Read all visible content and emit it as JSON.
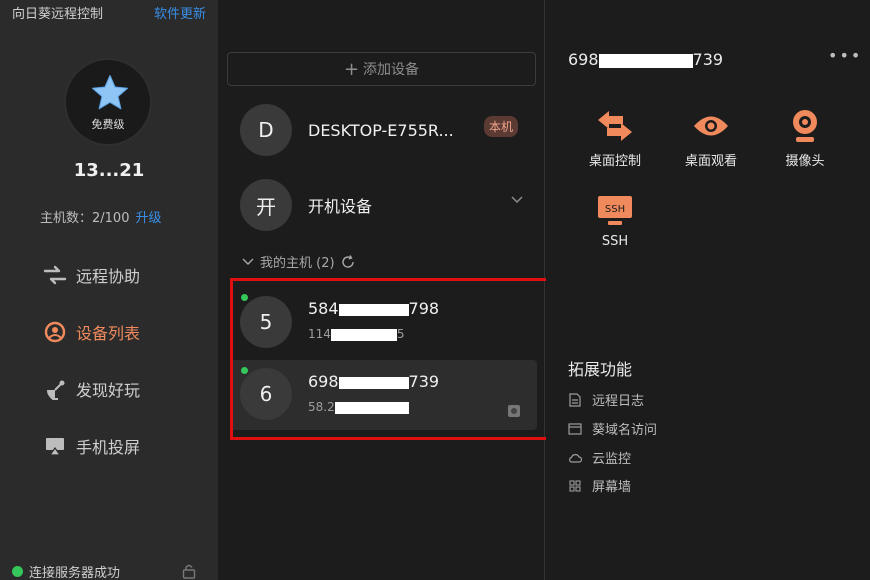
{
  "window": {
    "app_title": "向日葵远程控制",
    "update_link": "软件更新",
    "menu_icon": "menu-icon",
    "minimize_icon": "minimize-icon",
    "close_icon": "close-icon"
  },
  "profile": {
    "plan": "免费级",
    "account_id": "13...21",
    "host_count_label": "主机数：2/100",
    "upgrade_label": "升级"
  },
  "nav": [
    {
      "label": "远程协助",
      "icon": "remote-assist-icon",
      "active": false
    },
    {
      "label": "设备列表",
      "icon": "device-list-icon",
      "active": true
    },
    {
      "label": "发现好玩",
      "icon": "discover-icon",
      "active": false
    },
    {
      "label": "手机投屏",
      "icon": "screen-cast-icon",
      "active": false
    }
  ],
  "status": {
    "text": "连接服务器成功",
    "color": "#35c759"
  },
  "devices": {
    "add_button": "添加设备",
    "local": {
      "initial": "D",
      "name": "DESKTOP-E755R...",
      "badge": "本机"
    },
    "boot": {
      "initial": "开",
      "name": "开机设备"
    },
    "group": {
      "label": "我的主机 (2)"
    },
    "hosts": [
      {
        "initial": "5",
        "id_prefix": "584",
        "id_suffix": "798",
        "ip_prefix": "114",
        "ip_suffix": "5",
        "online": true,
        "selected": false
      },
      {
        "initial": "6",
        "id_prefix": "698",
        "id_suffix": "739",
        "ip_prefix": "58.2",
        "ip_suffix": "",
        "online": true,
        "selected": true
      }
    ]
  },
  "detail": {
    "id_prefix": "698",
    "id_suffix": "739",
    "actions": [
      {
        "label": "桌面控制",
        "icon": "desktop-control-icon"
      },
      {
        "label": "桌面观看",
        "icon": "desktop-view-icon"
      },
      {
        "label": "摄像头",
        "icon": "camera-icon"
      },
      {
        "label": "SSH",
        "icon": "ssh-icon"
      }
    ],
    "extensions_title": "拓展功能",
    "extensions": [
      {
        "label": "远程日志",
        "icon": "document-icon"
      },
      {
        "label": "葵域名访问",
        "icon": "domain-icon"
      },
      {
        "label": "云监控",
        "icon": "cloud-icon"
      },
      {
        "label": "屏幕墙",
        "icon": "grid-icon"
      }
    ]
  },
  "colors": {
    "accent": "#f08a5d",
    "link": "#3a8ee6",
    "highlight": "#e01010"
  }
}
